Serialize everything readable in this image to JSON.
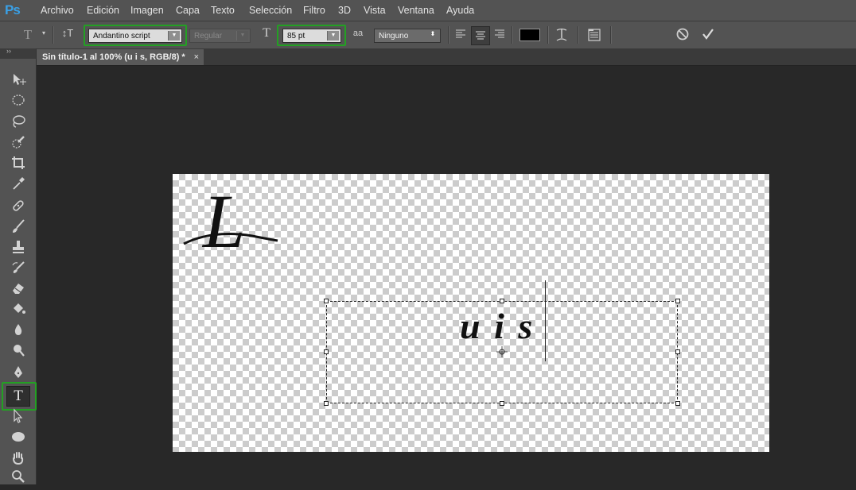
{
  "app": {
    "logo": "Ps"
  },
  "menu": [
    "Archivo",
    "Edición",
    "Imagen",
    "Capa",
    "Texto",
    "Selección",
    "Filtro",
    "3D",
    "Vista",
    "Ventana",
    "Ayuda"
  ],
  "options": {
    "tool_icon": "T",
    "orient_icon": "↕T",
    "font_family": "Andantino script",
    "font_style": "Regular",
    "size_icon": "T",
    "font_size": "85 pt",
    "aa_icon": "aa",
    "antialias": "Ninguno",
    "text_color": "#000000",
    "accent_highlight": "#23a023"
  },
  "document": {
    "tab_title": "Sin título-1 al 100% (u i s, RGB/8) *",
    "tab_close": "×",
    "typed_text": "u i s",
    "glyph_L": "L"
  },
  "toolbar": {
    "selected_tool": "type-tool",
    "type_label": "T"
  }
}
